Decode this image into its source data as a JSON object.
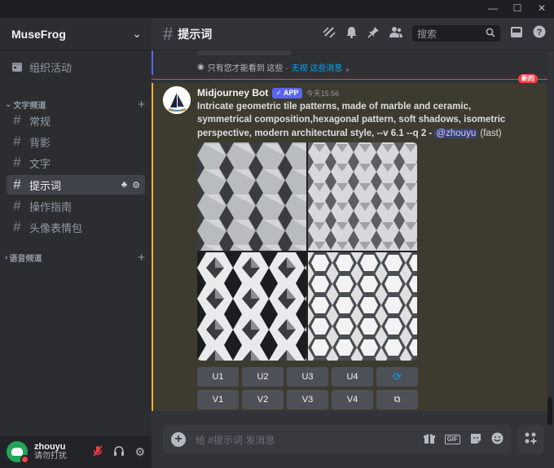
{
  "window": {
    "minimize": "—",
    "maximize": "☐",
    "close": "✕"
  },
  "server": {
    "name": "MuseFrog"
  },
  "events": {
    "label": "组织活动"
  },
  "categories": {
    "text": "文字频道",
    "voice": "语音频道"
  },
  "channels": [
    {
      "name": "常规"
    },
    {
      "name": "背影"
    },
    {
      "name": "文字"
    },
    {
      "name": "提示词"
    },
    {
      "name": "操作指南"
    },
    {
      "name": "头像表情包"
    }
  ],
  "user": {
    "name": "zhouyu",
    "status": "请勿打扰"
  },
  "header": {
    "channel": "提示词",
    "search_placeholder": "搜索"
  },
  "ephemeral": {
    "note": "只有您才能看到 这些 ·",
    "dismiss": "无视 这些消息",
    "dismiss_suffix": "。"
  },
  "divider": {
    "label": "新的"
  },
  "message": {
    "author": "Midjourney Bot",
    "badge": "APP",
    "time": "今天15:56",
    "prompt": "Intricate geometric tile patterns, made of marble and ceramic, symmetrical composition,hexagonal pattern, soft shadows, isometric perspective, modern architectural style, --v 6.1 --q 2",
    "dash": " - ",
    "mention": "@zhouyu",
    "speed": " (fast)"
  },
  "buttons_row1": [
    "U1",
    "U2",
    "U3",
    "U4"
  ],
  "buttons_row2": [
    "V1",
    "V2",
    "V3",
    "V4"
  ],
  "composer": {
    "placeholder": "给 #提示词 发消息"
  },
  "colors": {
    "accent": "#5865f2",
    "highlight_bar": "#f0b232",
    "new_divider": "#f23f43",
    "dnd": "#f23f43",
    "link": "#00a8fc"
  }
}
